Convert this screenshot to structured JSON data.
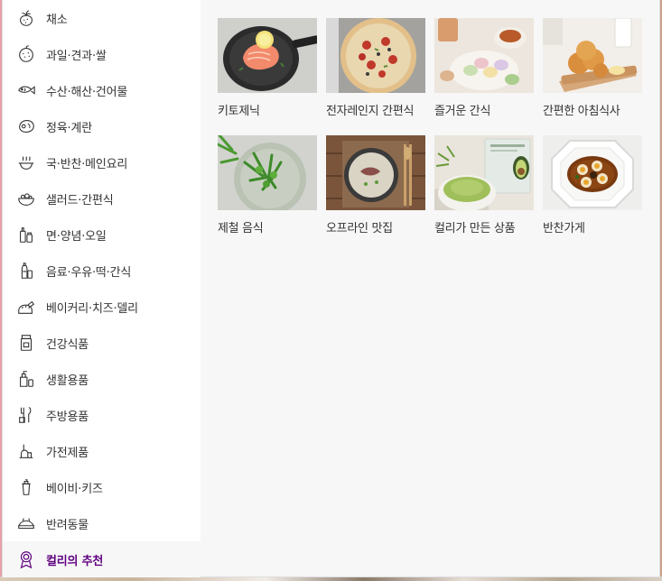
{
  "sidebar": {
    "items": [
      {
        "label": "채소",
        "icon": "vegetable-icon"
      },
      {
        "label": "과일·견과·쌀",
        "icon": "fruit-icon"
      },
      {
        "label": "수산·해산·건어물",
        "icon": "fish-icon"
      },
      {
        "label": "정육·계란",
        "icon": "meat-icon"
      },
      {
        "label": "국·반찬·메인요리",
        "icon": "pot-icon"
      },
      {
        "label": "샐러드·간편식",
        "icon": "salad-icon"
      },
      {
        "label": "면·양념·오일",
        "icon": "seasoning-icon"
      },
      {
        "label": "음료·우유·떡·간식",
        "icon": "drink-icon"
      },
      {
        "label": "베이커리·치즈·델리",
        "icon": "bread-icon"
      },
      {
        "label": "건강식품",
        "icon": "health-icon"
      },
      {
        "label": "생활용품",
        "icon": "living-icon"
      },
      {
        "label": "주방용품",
        "icon": "kitchen-icon"
      },
      {
        "label": "가전제품",
        "icon": "appliance-icon"
      },
      {
        "label": "베이비·키즈",
        "icon": "baby-icon"
      },
      {
        "label": "반려동물",
        "icon": "pet-icon"
      },
      {
        "label": "컬리의 추천",
        "icon": "ribbon-icon"
      }
    ],
    "active_index": 15,
    "accent_color": "#5f0080"
  },
  "panel": {
    "tiles": [
      {
        "label": "키토제닉",
        "image": "salmon-steak-image"
      },
      {
        "label": "전자레인지 간편식",
        "image": "pizza-image"
      },
      {
        "label": "즐거운 간식",
        "image": "macaron-tea-image"
      },
      {
        "label": "간편한 아침식사",
        "image": "bread-rolls-image"
      },
      {
        "label": "제철 음식",
        "image": "herb-salad-image"
      },
      {
        "label": "오프라인 맛집",
        "image": "beef-soup-image"
      },
      {
        "label": "컬리가 만든 상품",
        "image": "avocado-product-image"
      },
      {
        "label": "반찬가게",
        "image": "braised-eggs-image"
      }
    ]
  }
}
